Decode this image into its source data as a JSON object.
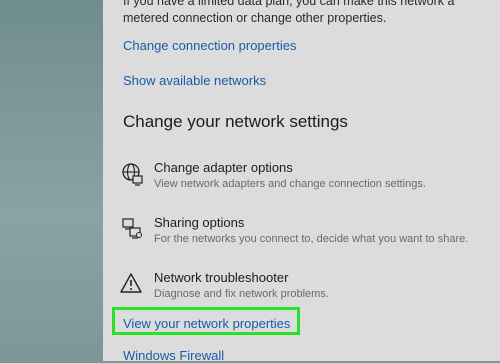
{
  "top_cut_text": "If you have a limited data plan, you can make this network a metered connection or change other properties.",
  "links": {
    "change_connection": "Change connection properties",
    "show_networks": "Show available networks",
    "view_properties": "View your network properties",
    "windows_firewall": "Windows Firewall"
  },
  "section_heading": "Change your network settings",
  "items": [
    {
      "title": "Change adapter options",
      "desc": "View network adapters and change connection settings.",
      "icon": "adapter-icon"
    },
    {
      "title": "Sharing options",
      "desc": "For the networks you connect to, decide what you want to share.",
      "icon": "sharing-icon"
    },
    {
      "title": "Network troubleshooter",
      "desc": "Diagnose and fix network problems.",
      "icon": "warning-icon"
    }
  ],
  "colors": {
    "link": "#1a5ca8",
    "highlight": "#27e227",
    "panel": "#dcdcdc"
  }
}
